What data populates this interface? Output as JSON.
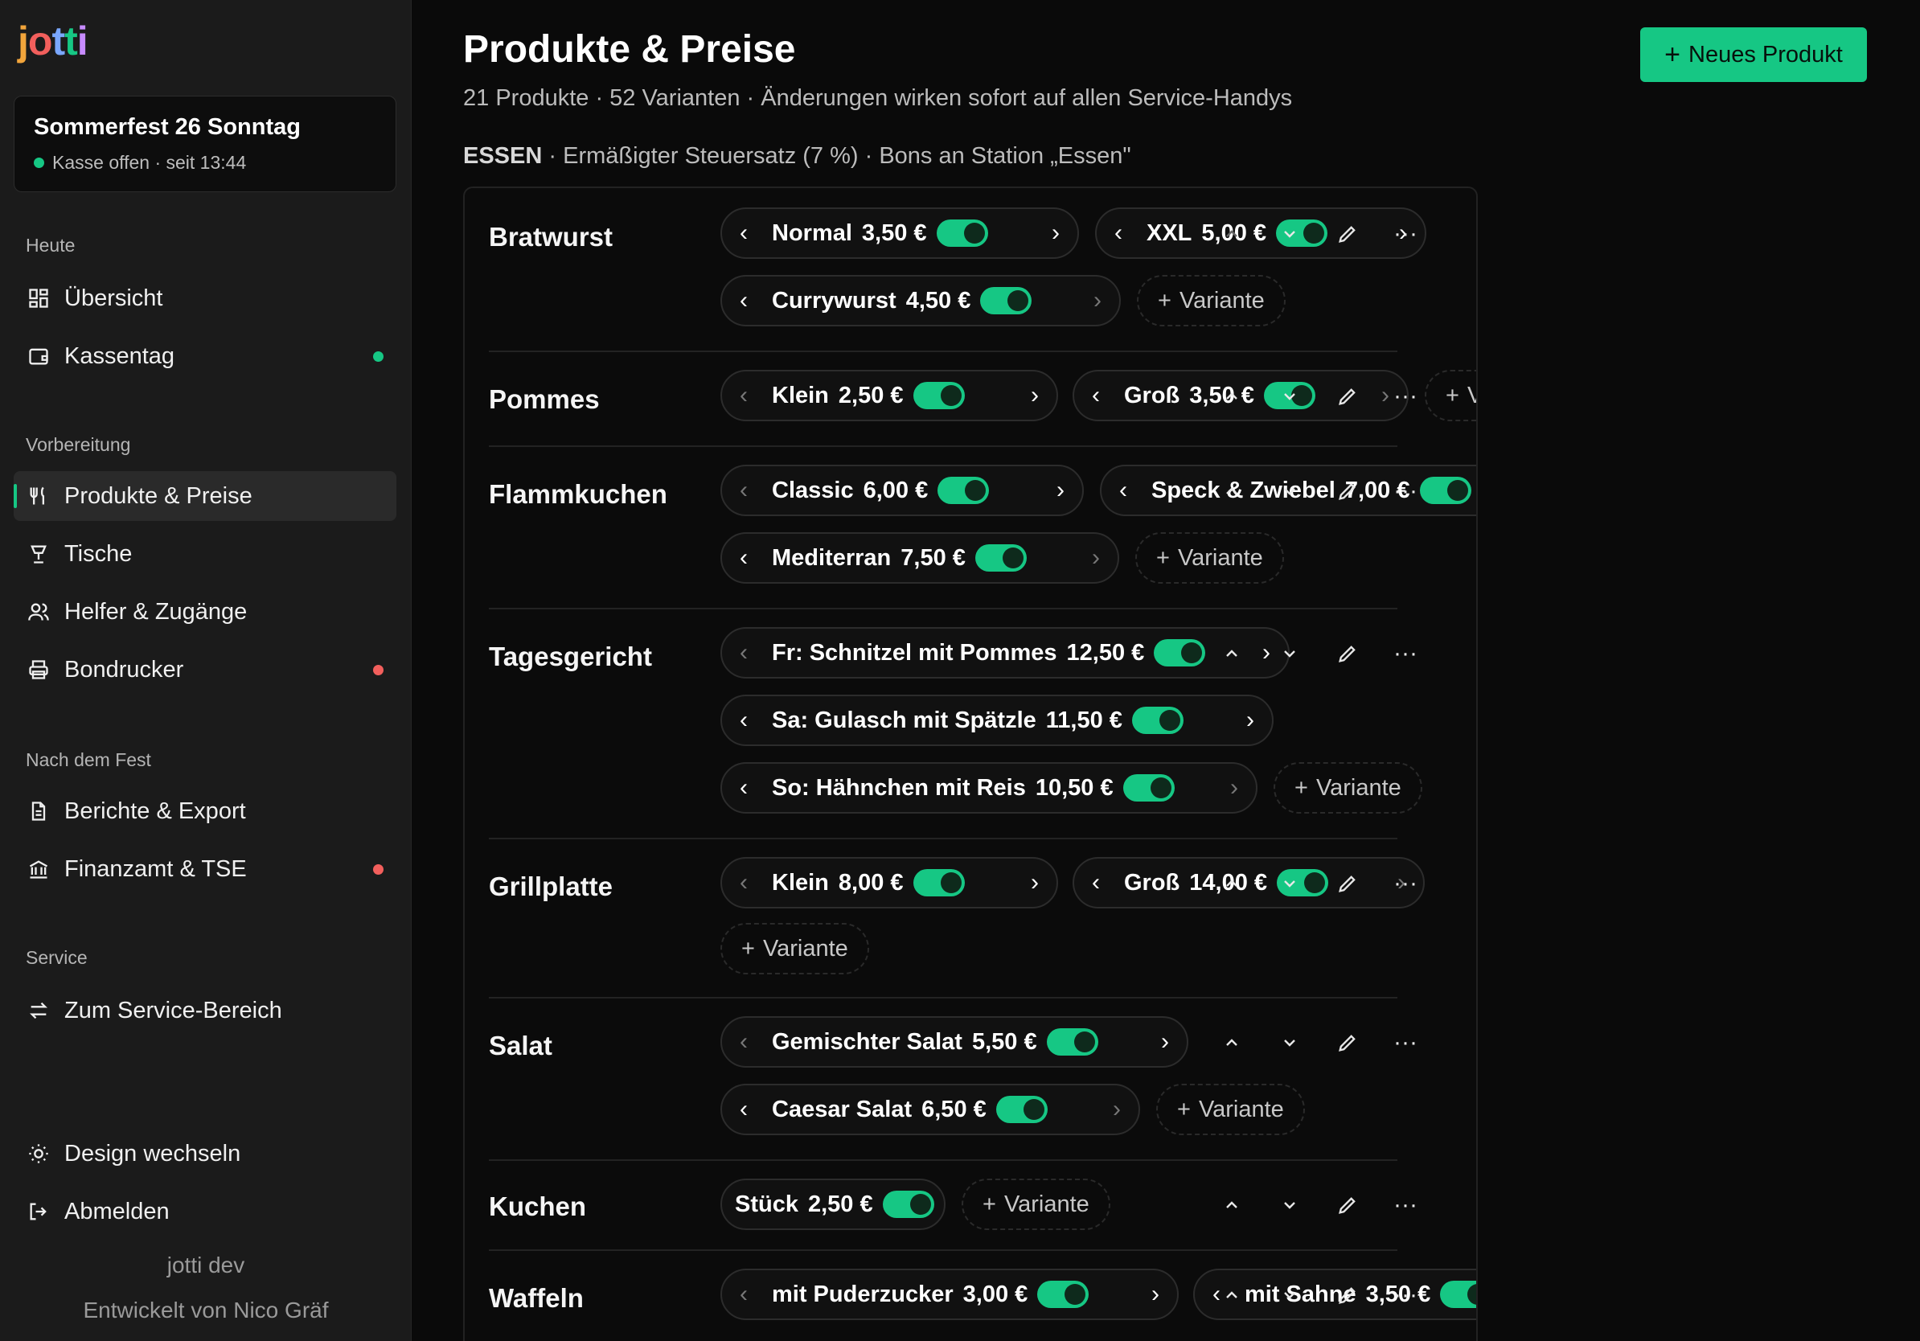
{
  "logo": {
    "text": "jotti"
  },
  "event": {
    "title": "Sommerfest 26 Sonntag",
    "status": "Kasse offen · seit 13:44"
  },
  "sections": {
    "heute": "Heute",
    "vorbereitung": "Vorbereitung",
    "nach": "Nach dem Fest",
    "service": "Service"
  },
  "nav": {
    "uebersicht": "Übersicht",
    "kassentag": "Kassentag",
    "produkte": "Produkte & Preise",
    "tische": "Tische",
    "helfer": "Helfer & Zugänge",
    "bondrucker": "Bondrucker",
    "berichte": "Berichte & Export",
    "finanzamt": "Finanzamt & TSE",
    "service": "Zum Service-Bereich",
    "design": "Design wechseln",
    "abmelden": "Abmelden"
  },
  "footer": {
    "env": "jotti dev",
    "dev": "Entwickelt von Nico Gräf"
  },
  "header": {
    "title": "Produkte & Preise",
    "subtitle": "21 Produkte · 52 Varianten · Änderungen wirken sofort auf allen Service-Handys",
    "new_button": "Neues Produkt"
  },
  "category": {
    "name": "ESSEN",
    "info": " · Ermäßigter Steuersatz (7 %) · Bons an Station „Essen\""
  },
  "add_variant_label": "Variante",
  "products": [
    {
      "name": "Bratwurst",
      "variants": [
        {
          "name": "Normal",
          "price": "3,50 €"
        },
        {
          "name": "XXL",
          "price": "5,00 €"
        },
        {
          "name": "Currywurst",
          "price": "4,50 €"
        }
      ]
    },
    {
      "name": "Pommes",
      "variants": [
        {
          "name": "Klein",
          "price": "2,50 €"
        },
        {
          "name": "Groß",
          "price": "3,50 €"
        }
      ]
    },
    {
      "name": "Flammkuchen",
      "variants": [
        {
          "name": "Classic",
          "price": "6,00 €"
        },
        {
          "name": "Speck & Zwiebel",
          "price": "7,00 €"
        },
        {
          "name": "Mediterran",
          "price": "7,50 €"
        }
      ]
    },
    {
      "name": "Tagesgericht",
      "variants": [
        {
          "name": "Fr: Schnitzel mit Pommes",
          "price": "12,50 €"
        },
        {
          "name": "Sa: Gulasch mit Spätzle",
          "price": "11,50 €"
        },
        {
          "name": "So: Hähnchen mit Reis",
          "price": "10,50 €"
        }
      ]
    },
    {
      "name": "Grillplatte",
      "variants": [
        {
          "name": "Klein",
          "price": "8,00 €"
        },
        {
          "name": "Groß",
          "price": "14,00 €"
        }
      ]
    },
    {
      "name": "Salat",
      "variants": [
        {
          "name": "Gemischter Salat",
          "price": "5,50 €"
        },
        {
          "name": "Caesar Salat",
          "price": "6,50 €"
        }
      ]
    },
    {
      "name": "Kuchen",
      "variants": [
        {
          "name": "Stück",
          "price": "2,50 €"
        }
      ]
    },
    {
      "name": "Waffeln",
      "variants": [
        {
          "name": "mit Puderzucker",
          "price": "3,00 €"
        },
        {
          "name": "mit Sahne",
          "price": "3,50 €"
        }
      ]
    }
  ],
  "colors": {
    "accent": "#16c784",
    "alert": "#f25f5c",
    "sidebar": "#1b1b1b",
    "background": "#0a0a0a"
  }
}
